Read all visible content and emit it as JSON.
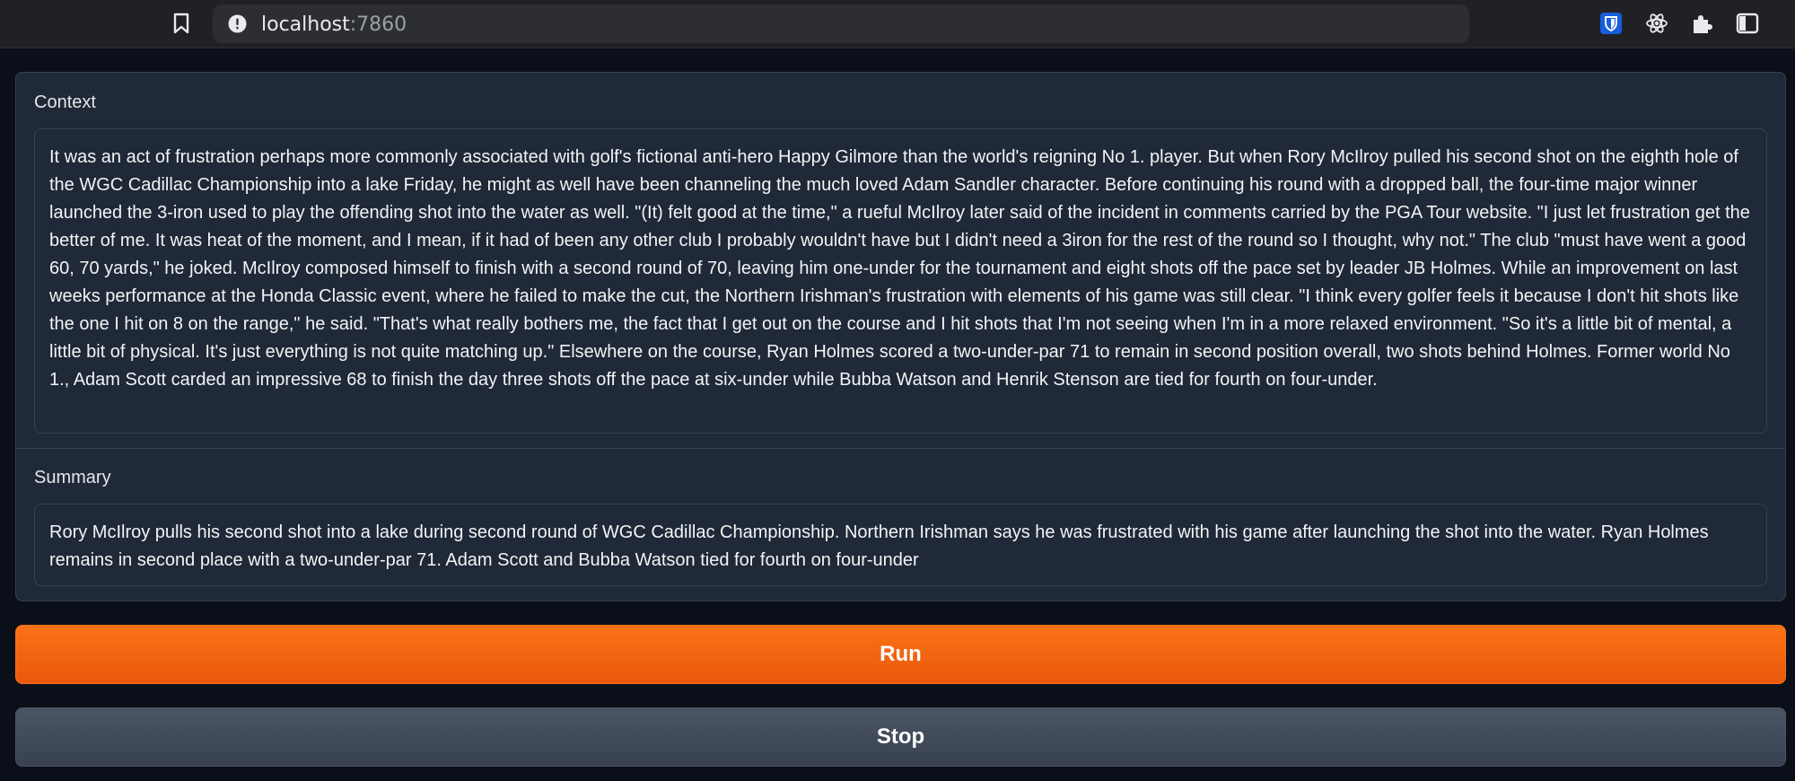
{
  "browser": {
    "url_host": "localhost",
    "url_port": ":7860",
    "icons": [
      "bookmark-icon",
      "info-icon",
      "bitwarden-icon",
      "react-devtools-icon",
      "extensions-icon",
      "side-panel-icon"
    ],
    "colors": {
      "chrome_bg": "#202124",
      "url_bg": "#2d2e31",
      "bitwarden": "#175ddc"
    }
  },
  "context": {
    "label": "Context",
    "text": "It was an act of frustration perhaps more commonly associated with golf's fictional anti-hero Happy Gilmore than the world's reigning No 1. player. But when Rory McIlroy pulled his second shot on the eighth hole of the WGC Cadillac Championship into a lake Friday, he might as well have been channeling the much loved Adam Sandler character. Before continuing his round with a dropped ball, the four-time major winner launched the 3-iron used to play the offending shot into the water as well. \"(It) felt good at the time,\" a rueful McIlroy later said of the incident in comments carried by the PGA Tour website. \"I just let frustration get the better of me. It was heat of the moment, and I mean, if it had of been any other club I probably wouldn't have but I didn't need a 3iron for the rest of the round so I thought, why not.\" The club \"must have went a good 60, 70 yards,\" he joked. McIlroy composed himself to finish with a second round of 70, leaving him one-under for the tournament and eight shots off the pace set by leader JB Holmes. While an improvement on last weeks performance at the Honda Classic event, where he failed to make the cut, the Northern Irishman's frustration with elements of his game was still clear. \"I think every golfer feels it because I don't hit shots like the one I hit on 8 on the range,\" he said. \"That's what really bothers me, the fact that I get out on the course and I hit shots that I'm not seeing when I'm in a more relaxed environment. \"So it's a little bit of mental, a little bit of physical. It's just everything is not quite matching up.\" Elsewhere on the course, Ryan Holmes scored a two-under-par 71 to remain in second position overall, two shots behind Holmes. Former world No 1., Adam Scott carded an impressive 68 to finish the day three shots off the pace at six-under while Bubba Watson and Henrik Stenson are tied for fourth on four-under."
  },
  "summary": {
    "label": "Summary",
    "text": "Rory McIlroy pulls his second shot into a lake during second round of WGC Cadillac Championship. Northern Irishman says he was frustrated with his game after launching the shot into the water. Ryan Holmes remains in second place with a two-under-par 71. Adam Scott and Bubba Watson tied for fourth on four-under"
  },
  "buttons": {
    "run_label": "Run",
    "stop_label": "Stop",
    "colors": {
      "run": "#f97316",
      "stop": "#4b5563"
    }
  },
  "theme": {
    "page_bg": "#0b0f19",
    "panel_bg": "#1f2937",
    "border": "#374151",
    "text": "#f3f4f6"
  }
}
